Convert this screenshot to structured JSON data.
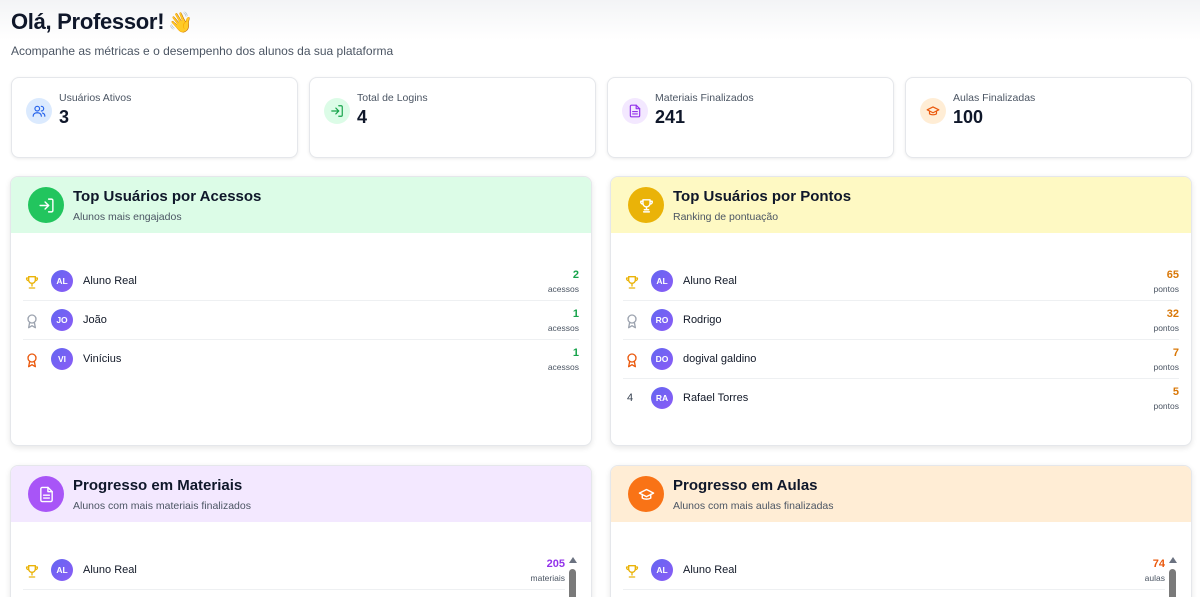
{
  "header": {
    "greeting": "Olá, Professor!",
    "wave": "👋",
    "subtitle": "Acompanhe as métricas e o desempenho dos alunos da sua plataforma"
  },
  "stats": [
    {
      "label": "Usuários Ativos",
      "value": "3",
      "icon": "users-icon",
      "color": "#2563eb",
      "bg": "#dbeafe"
    },
    {
      "label": "Total de Logins",
      "value": "4",
      "icon": "login-icon",
      "color": "#16a34a",
      "bg": "#dcfce7"
    },
    {
      "label": "Materiais Finalizados",
      "value": "241",
      "icon": "document-icon",
      "color": "#9333ea",
      "bg": "#f3e8ff"
    },
    {
      "label": "Aulas Finalizadas",
      "value": "100",
      "icon": "graduation-cap-icon",
      "color": "#ea580c",
      "bg": "#ffedd5"
    }
  ],
  "panels": {
    "acessos": {
      "title": "Top Usuários por Acessos",
      "subtitle": "Alunos mais engajados",
      "accent": "#16a34a",
      "head_bg": "#dcfce7",
      "icon_bg": "#22c55e",
      "rows": [
        {
          "rank": "1",
          "initials": "AL",
          "name": "Aluno Real",
          "value": "2",
          "unit": "acessos"
        },
        {
          "rank": "2",
          "initials": "JO",
          "name": "João",
          "value": "1",
          "unit": "acessos"
        },
        {
          "rank": "3",
          "initials": "VI",
          "name": "Vinícius",
          "value": "1",
          "unit": "acessos"
        }
      ]
    },
    "pontos": {
      "title": "Top Usuários por Pontos",
      "subtitle": "Ranking de pontuação",
      "accent": "#d97706",
      "head_bg": "#fef9c3",
      "icon_bg": "#eab308",
      "rows": [
        {
          "rank": "1",
          "initials": "AL",
          "name": "Aluno Real",
          "value": "65",
          "unit": "pontos"
        },
        {
          "rank": "2",
          "initials": "RO",
          "name": "Rodrigo",
          "value": "32",
          "unit": "pontos"
        },
        {
          "rank": "3",
          "initials": "DO",
          "name": "dogival galdino",
          "value": "7",
          "unit": "pontos"
        },
        {
          "rank": "4",
          "initials": "RA",
          "name": "Rafael Torres",
          "value": "5",
          "unit": "pontos"
        }
      ]
    },
    "materiais": {
      "title": "Progresso em Materiais",
      "subtitle": "Alunos com mais materiais finalizados",
      "accent": "#9333ea",
      "head_bg": "#f3e8ff",
      "icon_bg": "#a855f7",
      "rows": [
        {
          "rank": "1",
          "initials": "AL",
          "name": "Aluno Real",
          "value": "205",
          "unit": "materiais"
        }
      ]
    },
    "aulas": {
      "title": "Progresso em Aulas",
      "subtitle": "Alunos com mais aulas finalizadas",
      "accent": "#ea580c",
      "head_bg": "#ffedd5",
      "icon_bg": "#f97316",
      "rows": [
        {
          "rank": "1",
          "initials": "AL",
          "name": "Aluno Real",
          "value": "74",
          "unit": "aulas"
        }
      ]
    }
  },
  "rank_colors": {
    "gold": "#eab308",
    "silver": "#9ca3af",
    "bronze": "#ea580c"
  }
}
